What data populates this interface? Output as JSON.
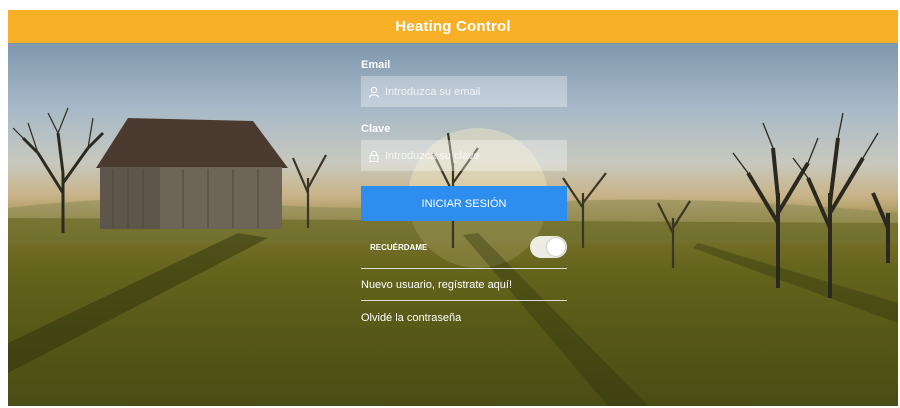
{
  "app": {
    "title": "Heating Control"
  },
  "login_form": {
    "email_label": "Email",
    "email_placeholder": "Introduzca su email",
    "password_label": "Clave",
    "password_placeholder": "Introduzca su clave",
    "submit_label": "INICIAR SESIÓN",
    "remember_label": "RECUÉRDAME",
    "remember_enabled": true,
    "register_link": "Nuevo usuario, regístrate aquí!",
    "forgot_link": "Olvidé la contraseña"
  },
  "colors": {
    "header": "#f7b025",
    "button": "#2d8ef0"
  },
  "icons": {
    "email_field": "user-icon",
    "password_field": "lock-icon"
  }
}
